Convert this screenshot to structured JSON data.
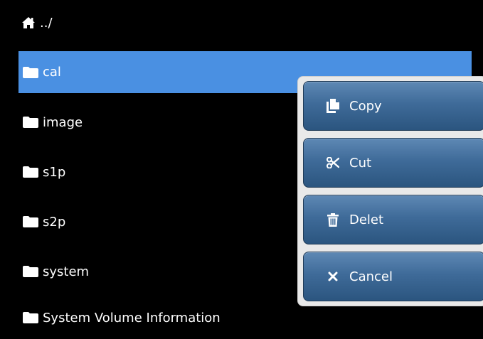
{
  "path_bar": {
    "icon": "home-icon",
    "path": "../"
  },
  "file_list": {
    "items": [
      {
        "name": "cal",
        "icon": "folder-icon",
        "selected": true
      },
      {
        "name": "image",
        "icon": "folder-icon",
        "selected": false
      },
      {
        "name": "s1p",
        "icon": "folder-icon",
        "selected": false
      },
      {
        "name": "s2p",
        "icon": "folder-icon",
        "selected": false
      },
      {
        "name": "system",
        "icon": "folder-icon",
        "selected": false
      },
      {
        "name": "System Volume Information",
        "icon": "folder-icon",
        "selected": false
      }
    ]
  },
  "context_menu": {
    "items": [
      {
        "label": "Copy",
        "icon": "copy-icon"
      },
      {
        "label": "Cut",
        "icon": "scissors-icon"
      },
      {
        "label": "Delet",
        "icon": "trash-icon"
      },
      {
        "label": "Cancel",
        "icon": "close-icon"
      }
    ]
  },
  "colors": {
    "background": "#000000",
    "selection": "#4a90e2",
    "menu_button": "#3f6b99",
    "menu_panel": "#e9e9e9"
  }
}
